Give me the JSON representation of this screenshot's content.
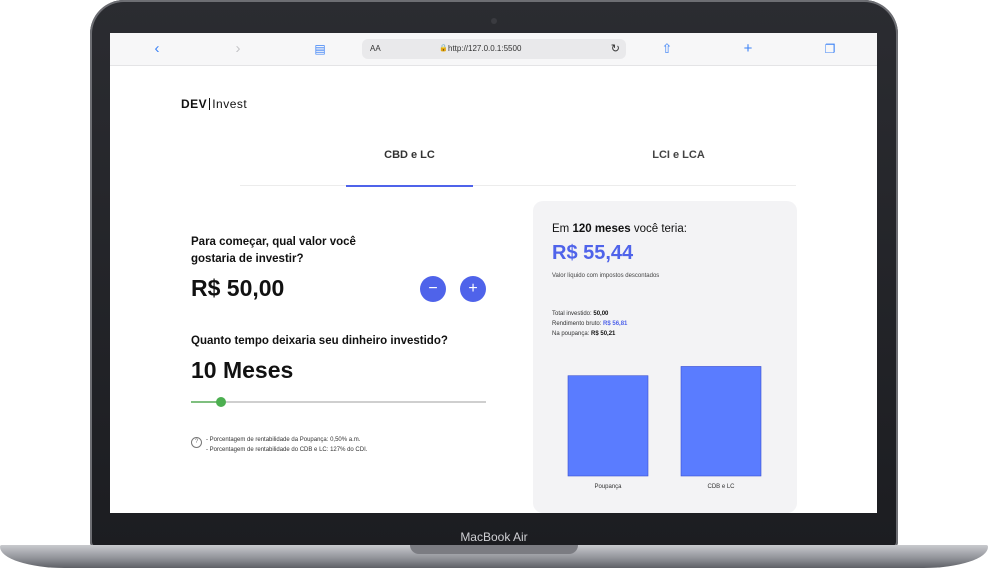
{
  "device": {
    "label": "MacBook Air"
  },
  "browser": {
    "text_size_label": "AA",
    "url": "http://127.0.0.1:5500",
    "icons": [
      "chevron-left-icon",
      "chevron-right-icon",
      "book-icon",
      "lock-icon",
      "reload-icon",
      "share-icon",
      "plus-icon",
      "tabs-icon"
    ]
  },
  "page": {
    "logo": {
      "part1": "DEV",
      "part2": "Invest"
    },
    "tabs": [
      {
        "label": "CBD e LC",
        "active": true
      },
      {
        "label": "LCI e LCA",
        "active": false
      }
    ],
    "investment": {
      "question": "Para começar, qual valor você gostaria de investir?",
      "amount": "R$ 50,00",
      "minus_label": "−",
      "plus_label": "+"
    },
    "duration": {
      "question": "Quanto tempo deixaria seu dinheiro investido?",
      "value": "10 Meses",
      "slider_fraction": 0.1
    },
    "notes": {
      "info_icon_label": "?",
      "line1": "- Porcentagem de rentabilidade da Poupança: 0,50% a.m.",
      "line2": "- Porcentagem de rentabilidade do CDB e LC: 127% do CDI."
    },
    "result": {
      "prefix": "Em",
      "months_text": "120 meses",
      "suffix": "você teria:",
      "value": "R$ 55,44",
      "subtitle": "Valor líquido com impostos descontados",
      "stats": [
        {
          "label": "Total investido:",
          "value": "50,00"
        },
        {
          "label": "Rendimento bruto:",
          "value": "R$ 56,81"
        },
        {
          "label": "Na poupança:",
          "value": "R$ 50,21"
        }
      ]
    },
    "colors": {
      "accent": "#4f63ea",
      "bar": "#5a7cff",
      "slider_thumb": "#4caf50"
    }
  },
  "chart_data": {
    "type": "bar",
    "categories": [
      "Poupança",
      "CDB e LC"
    ],
    "values": [
      50.21,
      56.81
    ],
    "ylim": [
      0,
      60
    ]
  }
}
